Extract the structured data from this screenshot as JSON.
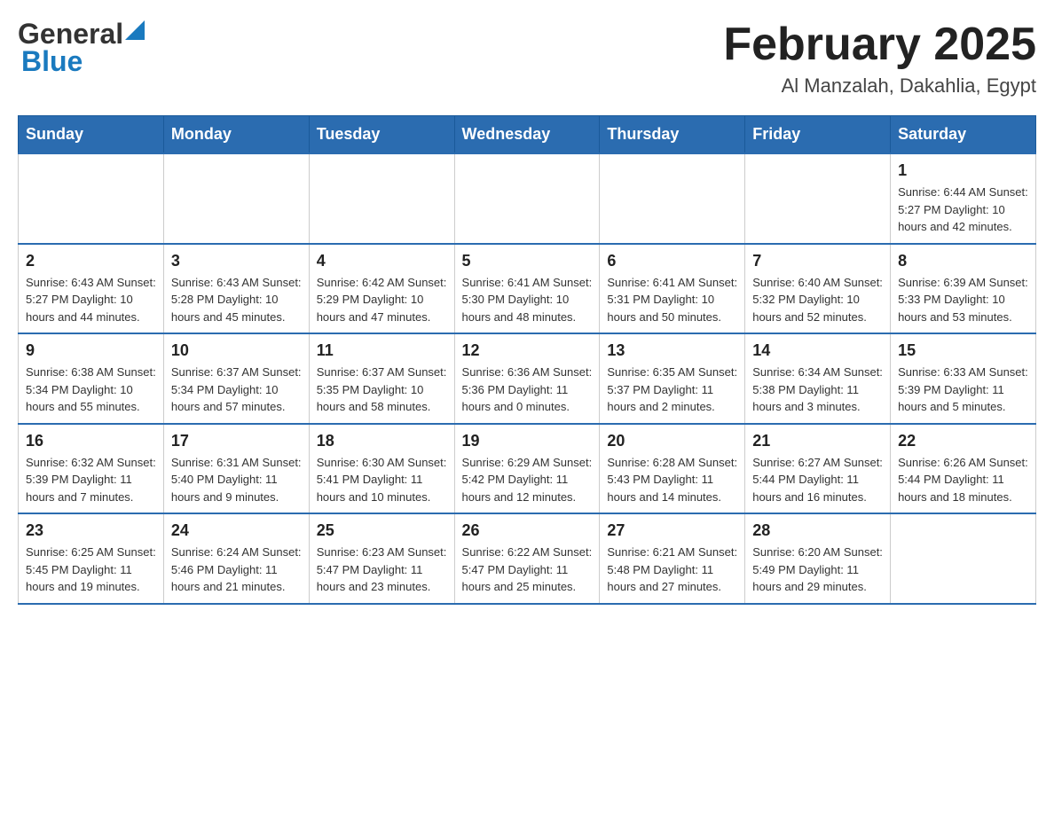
{
  "header": {
    "logo_general": "General",
    "logo_blue": "Blue",
    "month_title": "February 2025",
    "location": "Al Manzalah, Dakahlia, Egypt"
  },
  "weekdays": [
    "Sunday",
    "Monday",
    "Tuesday",
    "Wednesday",
    "Thursday",
    "Friday",
    "Saturday"
  ],
  "weeks": [
    [
      {
        "day": "",
        "info": ""
      },
      {
        "day": "",
        "info": ""
      },
      {
        "day": "",
        "info": ""
      },
      {
        "day": "",
        "info": ""
      },
      {
        "day": "",
        "info": ""
      },
      {
        "day": "",
        "info": ""
      },
      {
        "day": "1",
        "info": "Sunrise: 6:44 AM\nSunset: 5:27 PM\nDaylight: 10 hours and 42 minutes."
      }
    ],
    [
      {
        "day": "2",
        "info": "Sunrise: 6:43 AM\nSunset: 5:27 PM\nDaylight: 10 hours and 44 minutes."
      },
      {
        "day": "3",
        "info": "Sunrise: 6:43 AM\nSunset: 5:28 PM\nDaylight: 10 hours and 45 minutes."
      },
      {
        "day": "4",
        "info": "Sunrise: 6:42 AM\nSunset: 5:29 PM\nDaylight: 10 hours and 47 minutes."
      },
      {
        "day": "5",
        "info": "Sunrise: 6:41 AM\nSunset: 5:30 PM\nDaylight: 10 hours and 48 minutes."
      },
      {
        "day": "6",
        "info": "Sunrise: 6:41 AM\nSunset: 5:31 PM\nDaylight: 10 hours and 50 minutes."
      },
      {
        "day": "7",
        "info": "Sunrise: 6:40 AM\nSunset: 5:32 PM\nDaylight: 10 hours and 52 minutes."
      },
      {
        "day": "8",
        "info": "Sunrise: 6:39 AM\nSunset: 5:33 PM\nDaylight: 10 hours and 53 minutes."
      }
    ],
    [
      {
        "day": "9",
        "info": "Sunrise: 6:38 AM\nSunset: 5:34 PM\nDaylight: 10 hours and 55 minutes."
      },
      {
        "day": "10",
        "info": "Sunrise: 6:37 AM\nSunset: 5:34 PM\nDaylight: 10 hours and 57 minutes."
      },
      {
        "day": "11",
        "info": "Sunrise: 6:37 AM\nSunset: 5:35 PM\nDaylight: 10 hours and 58 minutes."
      },
      {
        "day": "12",
        "info": "Sunrise: 6:36 AM\nSunset: 5:36 PM\nDaylight: 11 hours and 0 minutes."
      },
      {
        "day": "13",
        "info": "Sunrise: 6:35 AM\nSunset: 5:37 PM\nDaylight: 11 hours and 2 minutes."
      },
      {
        "day": "14",
        "info": "Sunrise: 6:34 AM\nSunset: 5:38 PM\nDaylight: 11 hours and 3 minutes."
      },
      {
        "day": "15",
        "info": "Sunrise: 6:33 AM\nSunset: 5:39 PM\nDaylight: 11 hours and 5 minutes."
      }
    ],
    [
      {
        "day": "16",
        "info": "Sunrise: 6:32 AM\nSunset: 5:39 PM\nDaylight: 11 hours and 7 minutes."
      },
      {
        "day": "17",
        "info": "Sunrise: 6:31 AM\nSunset: 5:40 PM\nDaylight: 11 hours and 9 minutes."
      },
      {
        "day": "18",
        "info": "Sunrise: 6:30 AM\nSunset: 5:41 PM\nDaylight: 11 hours and 10 minutes."
      },
      {
        "day": "19",
        "info": "Sunrise: 6:29 AM\nSunset: 5:42 PM\nDaylight: 11 hours and 12 minutes."
      },
      {
        "day": "20",
        "info": "Sunrise: 6:28 AM\nSunset: 5:43 PM\nDaylight: 11 hours and 14 minutes."
      },
      {
        "day": "21",
        "info": "Sunrise: 6:27 AM\nSunset: 5:44 PM\nDaylight: 11 hours and 16 minutes."
      },
      {
        "day": "22",
        "info": "Sunrise: 6:26 AM\nSunset: 5:44 PM\nDaylight: 11 hours and 18 minutes."
      }
    ],
    [
      {
        "day": "23",
        "info": "Sunrise: 6:25 AM\nSunset: 5:45 PM\nDaylight: 11 hours and 19 minutes."
      },
      {
        "day": "24",
        "info": "Sunrise: 6:24 AM\nSunset: 5:46 PM\nDaylight: 11 hours and 21 minutes."
      },
      {
        "day": "25",
        "info": "Sunrise: 6:23 AM\nSunset: 5:47 PM\nDaylight: 11 hours and 23 minutes."
      },
      {
        "day": "26",
        "info": "Sunrise: 6:22 AM\nSunset: 5:47 PM\nDaylight: 11 hours and 25 minutes."
      },
      {
        "day": "27",
        "info": "Sunrise: 6:21 AM\nSunset: 5:48 PM\nDaylight: 11 hours and 27 minutes."
      },
      {
        "day": "28",
        "info": "Sunrise: 6:20 AM\nSunset: 5:49 PM\nDaylight: 11 hours and 29 minutes."
      },
      {
        "day": "",
        "info": ""
      }
    ]
  ]
}
